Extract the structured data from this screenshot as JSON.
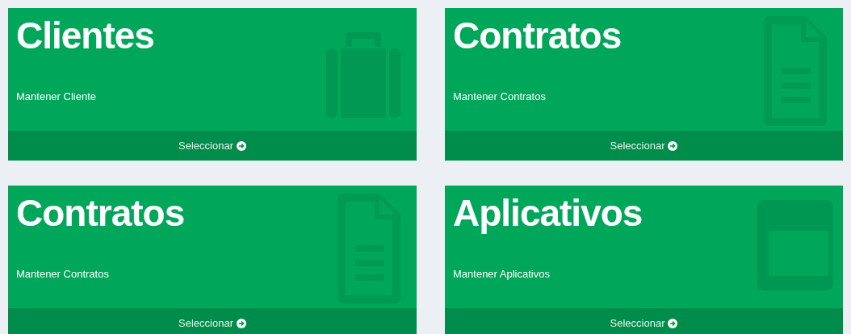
{
  "cards": [
    {
      "title": "Clientes",
      "subtitle": "Mantener Cliente",
      "link": "Seleccionar",
      "kind": "briefcase"
    },
    {
      "title": "Contratos",
      "subtitle": "Mantener Contratos",
      "link": "Seleccionar",
      "kind": "document"
    },
    {
      "title": "Contratos",
      "subtitle": "Mantener Contratos",
      "link": "Seleccionar",
      "kind": "document"
    },
    {
      "title": "Aplicativos",
      "subtitle": "Mantener Aplicativos",
      "link": "Seleccionar",
      "kind": "window"
    }
  ]
}
